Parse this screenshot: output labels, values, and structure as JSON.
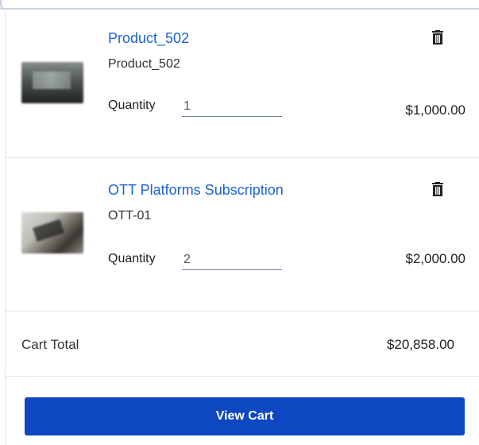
{
  "cart": {
    "items": [
      {
        "name": "Product_502",
        "sku": "Product_502",
        "quantity_label": "Quantity",
        "quantity": "1",
        "price": "$1,000.00",
        "delete_icon": "trash-icon"
      },
      {
        "name": "OTT Platforms Subscription",
        "sku": "OTT-01",
        "quantity_label": "Quantity",
        "quantity": "2",
        "price": "$2,000.00",
        "delete_icon": "trash-icon"
      }
    ],
    "total_label": "Cart Total",
    "total_value": "$20,858.00",
    "view_cart_label": "View Cart"
  },
  "colors": {
    "link": "#1a63d6",
    "button": "#0d47c1"
  }
}
